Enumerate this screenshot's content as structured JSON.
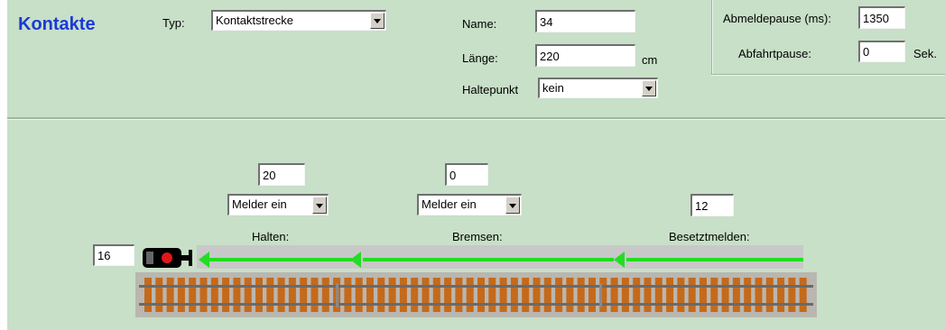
{
  "header": {
    "title": "Kontakte",
    "typ_label": "Typ:",
    "typ_value": "Kontaktstrecke",
    "name_label": "Name:",
    "name_value": "34",
    "laenge_label": "Länge:",
    "laenge_value": "220",
    "laenge_unit": "cm",
    "haltepunkt_label": "Haltepunkt",
    "haltepunkt_value": "kein",
    "abmeldepause_label": "Abmeldepause (ms):",
    "abmeldepause_value": "1350",
    "abfahrtpause_label": "Abfahrtpause:",
    "abfahrtpause_value": "0",
    "abfahrtpause_unit": "Sek."
  },
  "track": {
    "signal_value": "16",
    "halten": {
      "value": "20",
      "mode": "Melder ein",
      "label": "Halten:"
    },
    "bremsen": {
      "value": "0",
      "mode": "Melder ein",
      "label": "Bremsen:"
    },
    "besetztmelden": {
      "value": "12",
      "label": "Besetztmelden:"
    },
    "colors": {
      "panel": "#c8dfc8",
      "arrow": "#22dd22",
      "title": "#1a3ad6",
      "sleeper": "#c46a1c",
      "rail": "#6a6a6a"
    }
  }
}
